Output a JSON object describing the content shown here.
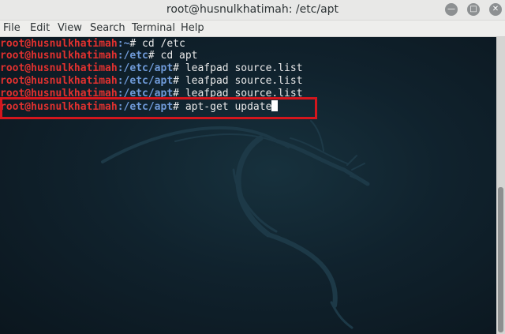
{
  "window": {
    "title": "root@husnulkhatimah: /etc/apt",
    "controls": {
      "minimize": "minimize-icon",
      "maximize": "maximize-icon",
      "close": "close-icon"
    }
  },
  "menu": {
    "file": "File",
    "edit": "Edit",
    "view": "View",
    "search": "Search",
    "terminal": "Terminal",
    "help": "Help"
  },
  "terminal": {
    "lines": [
      {
        "user": "root@husnulkhatimah",
        "path": ":~",
        "cmd": "# cd /etc"
      },
      {
        "user": "root@husnulkhatimah",
        "path": ":/etc",
        "cmd": "# cd apt"
      },
      {
        "user": "root@husnulkhatimah",
        "path": ":/etc/apt",
        "cmd": "# leafpad source.list"
      },
      {
        "user": "root@husnulkhatimah",
        "path": ":/etc/apt",
        "cmd": "# leafpad source.list"
      },
      {
        "user": "root@husnulkhatimah",
        "path": ":/etc/apt",
        "cmd": "# leafpad source.list"
      },
      {
        "user": "root@husnulkhatimah",
        "path": ":/etc/apt",
        "cmd": "# apt-get update"
      }
    ]
  },
  "colors": {
    "prompt_user": "#e0312f",
    "prompt_path": "#6f9ad8",
    "highlight_box": "#d3161d"
  }
}
